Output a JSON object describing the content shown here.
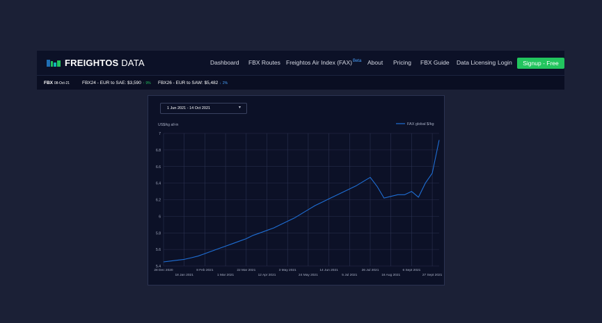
{
  "brand": {
    "name_bold": "FREIGHTOS",
    "name_light": "DATA",
    "colors": [
      "#1f6fb5",
      "#22c55e",
      "#0fb5b5"
    ]
  },
  "nav": {
    "items": [
      {
        "label": "Dashboard"
      },
      {
        "label": "FBX Routes"
      },
      {
        "label": "Freightos Air Index (FAX)",
        "badge": "Beta"
      },
      {
        "label": "About"
      },
      {
        "label": "Pricing"
      },
      {
        "label": "FBX Guide"
      },
      {
        "label": "Data Licensing"
      },
      {
        "label": "Login"
      }
    ],
    "signup_label": "Signup - Free"
  },
  "ticker": {
    "fbx_label": "FBX",
    "fbx_date": "08-Oct-21",
    "items": [
      {
        "label": "FBX24 - EUR to SAE: $3,590",
        "change": "9%",
        "direction": "up"
      },
      {
        "label": "FBX26 - EUR to SAW: $5,482",
        "change": "2%",
        "direction": "down"
      }
    ]
  },
  "date_range": {
    "value": "1 Jun 2021 - 14 Oct 2021",
    "caret": "▾"
  },
  "colors": {
    "line": "#1f6fd6",
    "grid": "#2a3150",
    "accent_green": "#22c55e",
    "accent_blue": "#4aa3ff"
  },
  "chart_data": {
    "type": "line",
    "title": "",
    "ylabel": "US$/kg all-in",
    "ylim": [
      5.4,
      7.0
    ],
    "yticks": [
      "7",
      "6.8",
      "6.6",
      "6.4",
      "6.2",
      "6",
      "5.8",
      "5.6",
      "5.4"
    ],
    "xlim": [
      "2020-12-28",
      "2021-10-04"
    ],
    "xticks_top": [
      "28 Dec 2020",
      "8 Feb 2021",
      "22 Mar 2021",
      "3 May 2021",
      "14 Jun 2021",
      "26 Jul 2021",
      "6 Sept 2021"
    ],
    "xticks_bottom": [
      "18 Jan 2021",
      "1 Mar 2021",
      "12 Apr 2021",
      "24 May 2021",
      "5 Jul 2021",
      "16 Aug 2021",
      "27 Sept 2021"
    ],
    "legend_position": "top-right",
    "series": [
      {
        "name": "FAX global $/kg",
        "x": [
          "2020-12-28",
          "2021-01-04",
          "2021-01-11",
          "2021-01-18",
          "2021-01-25",
          "2021-02-01",
          "2021-02-08",
          "2021-02-15",
          "2021-02-22",
          "2021-03-01",
          "2021-03-08",
          "2021-03-15",
          "2021-03-22",
          "2021-03-29",
          "2021-04-05",
          "2021-04-12",
          "2021-04-19",
          "2021-04-26",
          "2021-05-03",
          "2021-05-10",
          "2021-05-17",
          "2021-05-24",
          "2021-05-31",
          "2021-06-07",
          "2021-06-14",
          "2021-06-21",
          "2021-06-28",
          "2021-07-05",
          "2021-07-12",
          "2021-07-19",
          "2021-07-26",
          "2021-08-02",
          "2021-08-09",
          "2021-08-16",
          "2021-08-23",
          "2021-08-30",
          "2021-09-06",
          "2021-09-13",
          "2021-09-20",
          "2021-09-27",
          "2021-10-04"
        ],
        "values": [
          5.45,
          5.46,
          5.47,
          5.48,
          5.5,
          5.52,
          5.55,
          5.58,
          5.61,
          5.64,
          5.67,
          5.7,
          5.73,
          5.77,
          5.8,
          5.83,
          5.86,
          5.9,
          5.94,
          5.98,
          6.03,
          6.08,
          6.13,
          6.17,
          6.21,
          6.25,
          6.29,
          6.33,
          6.37,
          6.42,
          6.47,
          6.36,
          6.22,
          6.24,
          6.26,
          6.26,
          6.3,
          6.23,
          6.4,
          6.52,
          6.92
        ]
      }
    ]
  }
}
